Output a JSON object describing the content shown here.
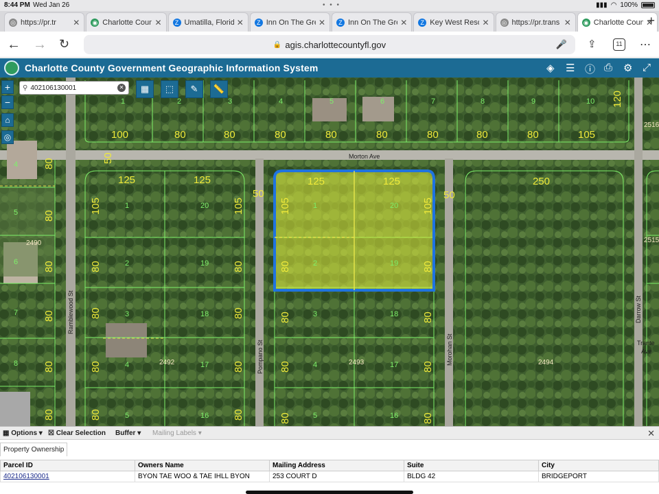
{
  "status_bar": {
    "time": "8:44 PM",
    "date": "Wed Jan 26",
    "battery": "100%"
  },
  "tabs": [
    {
      "title": "https://pr.tr",
      "favicon": "globe-icon",
      "color": "#8a8a8a"
    },
    {
      "title": "Charlotte Coun",
      "favicon": "ccgis-icon",
      "color": "#2f9b5e"
    },
    {
      "title": "Umatilla, Florid",
      "favicon": "zillow-icon",
      "color": "#1277e1"
    },
    {
      "title": "Inn On The Gre",
      "favicon": "zillow-icon",
      "color": "#1277e1"
    },
    {
      "title": "Inn On The Gre",
      "favicon": "zillow-icon",
      "color": "#1277e1"
    },
    {
      "title": "Key West Resor",
      "favicon": "zillow-icon",
      "color": "#1277e1"
    },
    {
      "title": "https://pr.trans",
      "favicon": "globe-icon",
      "color": "#8a8a8a"
    },
    {
      "title": "Charlotte Coun",
      "favicon": "ccgis-icon",
      "color": "#2f9b5e",
      "active": true
    }
  ],
  "toolbar": {
    "url": "agis.charlottecountyfl.gov",
    "tab_count": "11"
  },
  "app": {
    "title": "Charlotte County Government Geographic Information System"
  },
  "map": {
    "search_value": "402106130001",
    "streets": {
      "morton": "Morton Ave",
      "ramblewood": "Ramblewood St",
      "pompano": "Pompano St",
      "morohan": "Morohan St",
      "darrow": "Darrow St",
      "tranter": "Trante",
      "tranter_ave": "Ave"
    },
    "blocks": {
      "b1": "2490",
      "b2": "2492",
      "b3": "2493",
      "b4": "2494",
      "b5": "2516",
      "b6": "2515"
    },
    "selected_parcel_color": "#1f73e0"
  },
  "panel_toolbar": {
    "options": "Options",
    "clear_selection": "Clear Selection",
    "buffer": "Buffer",
    "mailing_labels": "Mailing Labels"
  },
  "panel": {
    "tab": "Property Ownership",
    "columns": [
      "Parcel ID",
      "Owners Name",
      "Mailing Address",
      "Suite",
      "City"
    ],
    "rows": [
      [
        "402106130001",
        "BYON TAE WOO & TAE IHLL BYON",
        "253 COURT D",
        "BLDG 42",
        "BRIDGEPORT"
      ]
    ]
  }
}
